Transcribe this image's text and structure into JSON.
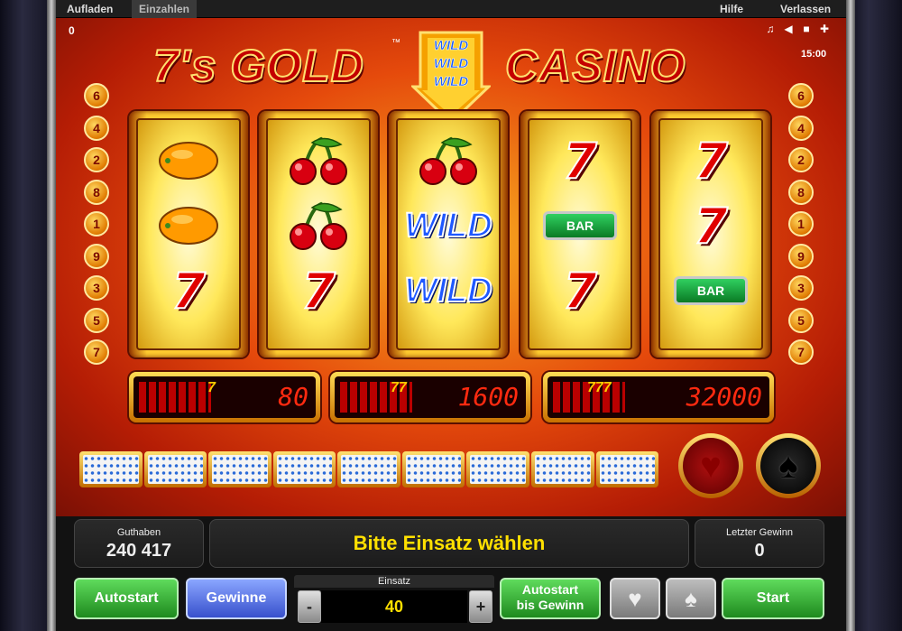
{
  "topbar": {
    "tab_load": "Aufladen",
    "tab_deposit": "Einzahlen",
    "help": "Hilfe",
    "leave": "Verlassen"
  },
  "status": {
    "credit_counter": "0",
    "clock": "15:00"
  },
  "logo": {
    "part1": "7's GOLD",
    "part2": "CASINO",
    "tm": "™",
    "wild_lines": [
      "WILD",
      "WILD",
      "WILD"
    ]
  },
  "lines_left": [
    "6",
    "4",
    "2",
    "8",
    "1",
    "9",
    "3",
    "5",
    "7"
  ],
  "lines_right": [
    "6",
    "4",
    "2",
    "8",
    "1",
    "9",
    "3",
    "5",
    "7"
  ],
  "reels": [
    [
      "orange",
      "orange",
      "seven"
    ],
    [
      "cherry",
      "cherry",
      "seven"
    ],
    [
      "cherry",
      "wild",
      "wild"
    ],
    [
      "seven",
      "bar",
      "seven"
    ],
    [
      "seven",
      "seven",
      "bar"
    ]
  ],
  "symbol_texts": {
    "wild": "WILD",
    "bar": "BAR",
    "seven": "7"
  },
  "paytable": [
    {
      "sevens": "7",
      "value": "80"
    },
    {
      "sevens": "77",
      "value": "1600"
    },
    {
      "sevens": "777",
      "value": "32000"
    }
  ],
  "gamble": {
    "red_symbol": "♥",
    "black_symbol": "♠"
  },
  "balance": {
    "label": "Guthaben",
    "value": "240 417"
  },
  "message": "Bitte Einsatz wählen",
  "last_win": {
    "label": "Letzter Gewinn",
    "value": "0"
  },
  "controls": {
    "autostart": "Autostart",
    "gewinne": "Gewinne",
    "einsatz_label": "Einsatz",
    "einsatz_value": "40",
    "minus": "-",
    "plus": "+",
    "autostart_win_line1": "Autostart",
    "autostart_win_line2": "bis Gewinn",
    "gamble_red": "♥",
    "gamble_black": "♠",
    "start": "Start"
  }
}
